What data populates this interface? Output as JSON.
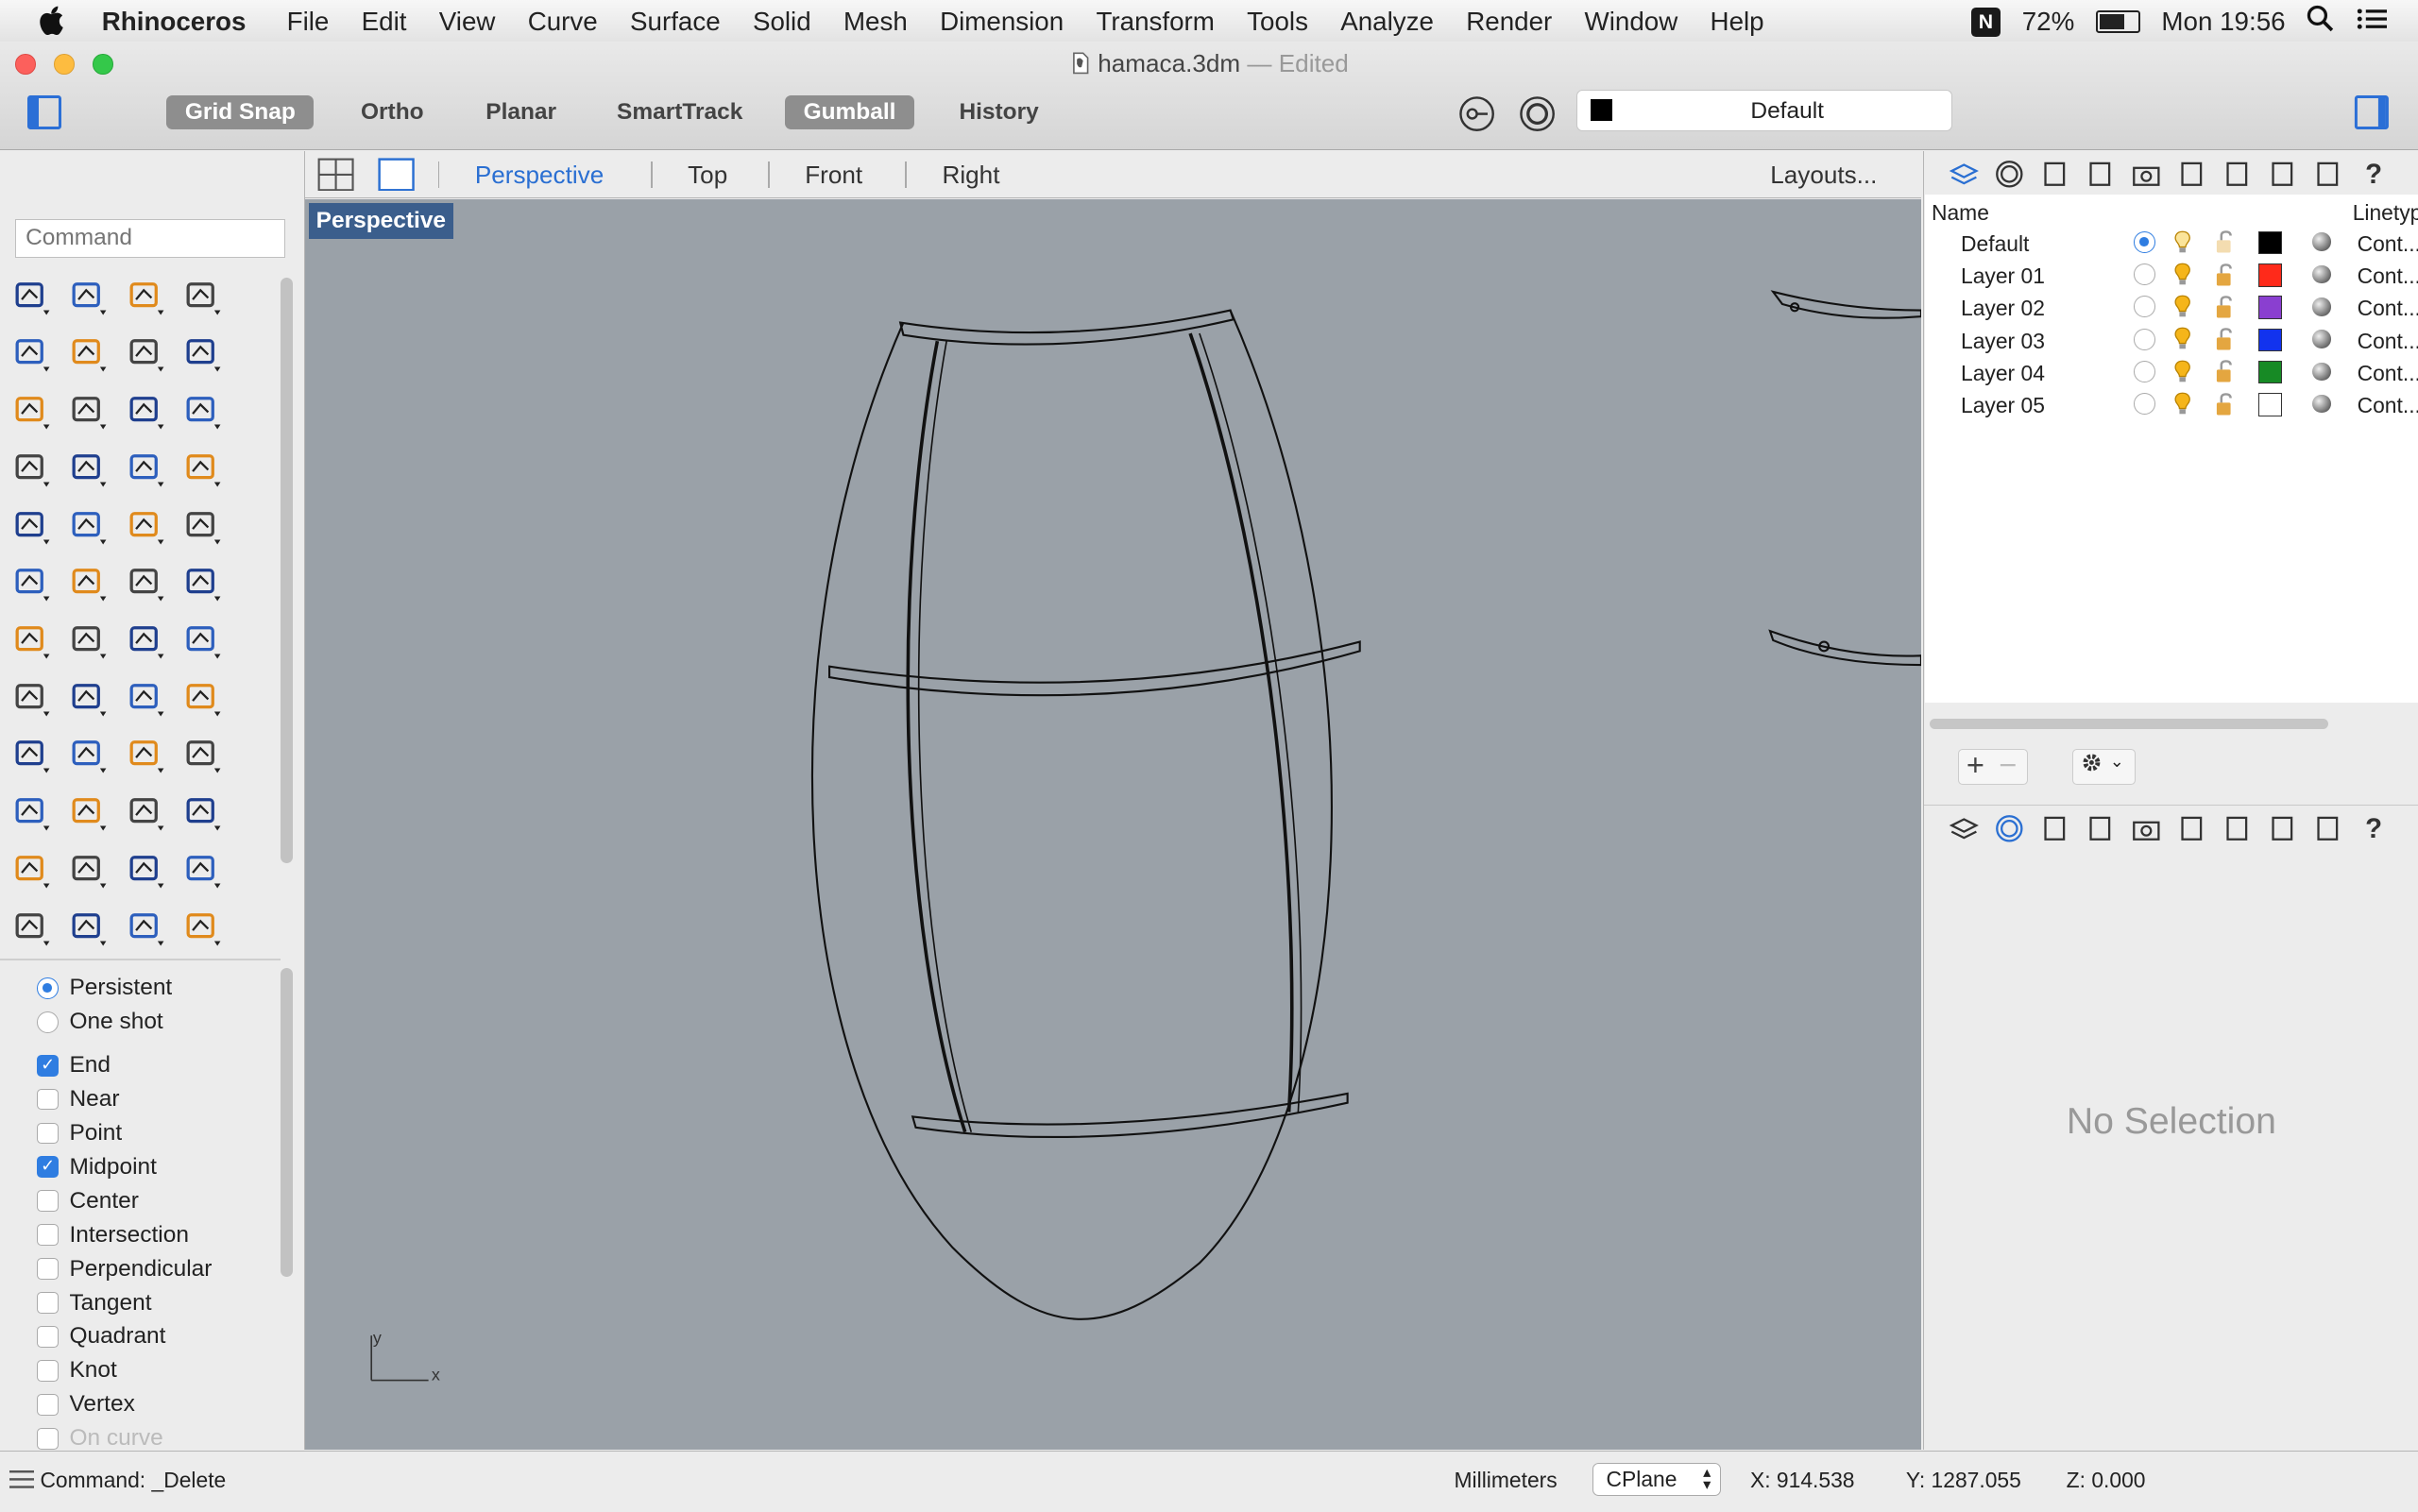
{
  "menubar": {
    "apple": "",
    "app_name": "Rhinoceros",
    "menus": [
      "File",
      "Edit",
      "View",
      "Curve",
      "Surface",
      "Solid",
      "Mesh",
      "Dimension",
      "Transform",
      "Tools",
      "Analyze",
      "Render",
      "Window",
      "Help"
    ],
    "battery": "72%",
    "clock": "Mon 19:56",
    "battery_level": 0.72
  },
  "window": {
    "filename": "hamaca.3dm",
    "status": "— Edited"
  },
  "toolbar": {
    "modes": [
      {
        "label": "Grid Snap",
        "on": true
      },
      {
        "label": "Ortho",
        "on": false
      },
      {
        "label": "Planar",
        "on": false
      },
      {
        "label": "SmartTrack",
        "on": false
      },
      {
        "label": "Gumball",
        "on": true
      },
      {
        "label": "History",
        "on": false
      }
    ],
    "current_layer": "Default",
    "current_layer_color": "#000000"
  },
  "command": {
    "placeholder": "Command"
  },
  "viewport_tabs": {
    "tabs": [
      "Perspective",
      "Top",
      "Front",
      "Right"
    ],
    "active": "Perspective",
    "layouts_label": "Layouts..."
  },
  "viewport": {
    "label": "Perspective",
    "axis_x": "x",
    "axis_y": "y"
  },
  "osnap": {
    "modes": [
      {
        "label": "Persistent",
        "selected": true
      },
      {
        "label": "One shot",
        "selected": false
      }
    ],
    "items": [
      {
        "label": "End",
        "checked": true
      },
      {
        "label": "Near",
        "checked": false
      },
      {
        "label": "Point",
        "checked": false
      },
      {
        "label": "Midpoint",
        "checked": true
      },
      {
        "label": "Center",
        "checked": false
      },
      {
        "label": "Intersection",
        "checked": false
      },
      {
        "label": "Perpendicular",
        "checked": false
      },
      {
        "label": "Tangent",
        "checked": false
      },
      {
        "label": "Quadrant",
        "checked": false
      },
      {
        "label": "Knot",
        "checked": false
      },
      {
        "label": "Vertex",
        "checked": false
      },
      {
        "label": "On curve",
        "checked": false
      }
    ]
  },
  "layers": {
    "col_name": "Name",
    "col_linetype": "Linetyp",
    "rows": [
      {
        "name": "Default",
        "current": true,
        "color": "#000000",
        "linetype": "Cont..."
      },
      {
        "name": "Layer 01",
        "current": false,
        "color": "#ff2a1a",
        "linetype": "Cont..."
      },
      {
        "name": "Layer 02",
        "current": false,
        "color": "#8a3fd0",
        "linetype": "Cont..."
      },
      {
        "name": "Layer 03",
        "current": false,
        "color": "#1233ee",
        "linetype": "Cont..."
      },
      {
        "name": "Layer 04",
        "current": false,
        "color": "#178a25",
        "linetype": "Cont..."
      },
      {
        "name": "Layer 05",
        "current": false,
        "color": "#ffffff",
        "linetype": "Cont..."
      }
    ]
  },
  "properties": {
    "empty_text": "No Selection"
  },
  "statusbar": {
    "command": "Command: _Delete",
    "units": "Millimeters",
    "cplane": "CPlane",
    "x": "X: 914.538",
    "y": "Y: 1287.055",
    "z": "Z: 0.000"
  }
}
